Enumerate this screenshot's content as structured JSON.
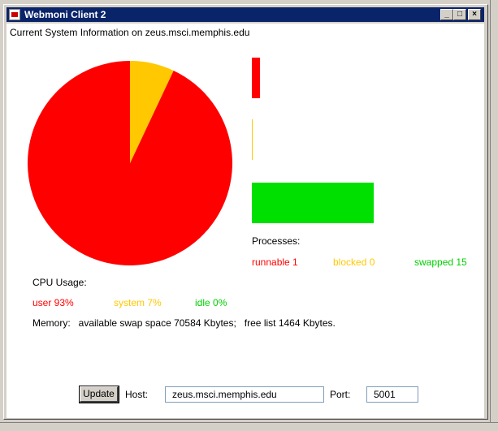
{
  "window": {
    "title": "Webmoni Client 2",
    "controls": {
      "minimize": "_",
      "maximize": "□",
      "close": "×"
    }
  },
  "header": {
    "system_info": "Current System Information on zeus.msci.memphis.edu"
  },
  "cpu": {
    "heading": "CPU Usage:",
    "user_label": "user 93%",
    "system_label": "system 7%",
    "idle_label": "idle 0%",
    "user_pct": 93,
    "system_pct": 7,
    "idle_pct": 0,
    "colors": {
      "user": "#ff0000",
      "system": "#ffc800",
      "idle": "#00e000"
    }
  },
  "memory": {
    "text": "Memory:   available swap space 70584 Kbytes;   free list 1464 Kbytes."
  },
  "processes": {
    "heading": "Processes:",
    "runnable_label": "runnable 1",
    "blocked_label": "blocked 0",
    "swapped_label": "swapped 15",
    "runnable": 1,
    "blocked": 0,
    "swapped": 15
  },
  "controls": {
    "update_label": "Update",
    "host_label": "Host:",
    "host_value": "zeus.msci.memphis.edu",
    "port_label": "Port:",
    "port_value": "5001"
  }
}
